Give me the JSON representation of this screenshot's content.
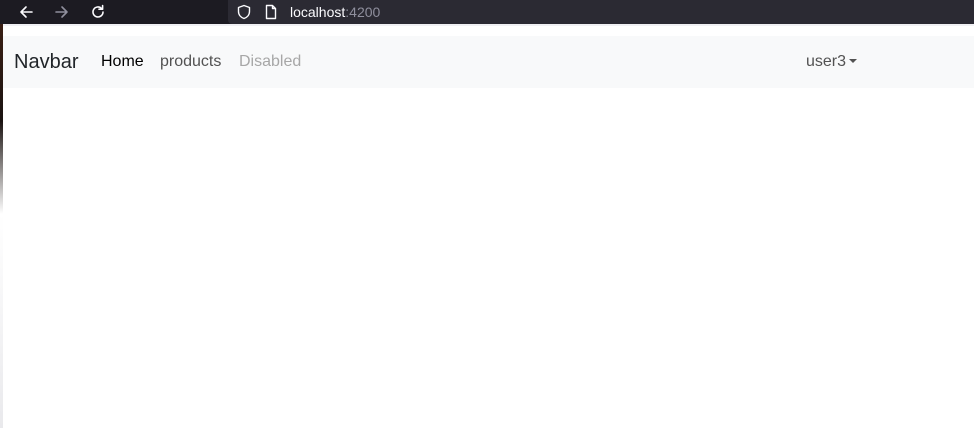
{
  "browser": {
    "url_host": "localhost",
    "url_port": ":4200",
    "back_icon": "arrow-left-icon",
    "forward_icon": "arrow-right-icon",
    "reload_icon": "reload-icon",
    "shield_icon": "shield-icon",
    "page_icon": "page-icon"
  },
  "navbar": {
    "brand": "Navbar",
    "links": [
      "Home",
      "products",
      "Disabled"
    ],
    "user_menu": "user3"
  },
  "colors": {
    "browser_chrome": "#1c1b22",
    "urlbar": "#2b2a33",
    "navbar_bg": "#f8f9fa",
    "active_link": "#000000",
    "link": "#525252",
    "disabled_link": "#a7a7a7"
  }
}
